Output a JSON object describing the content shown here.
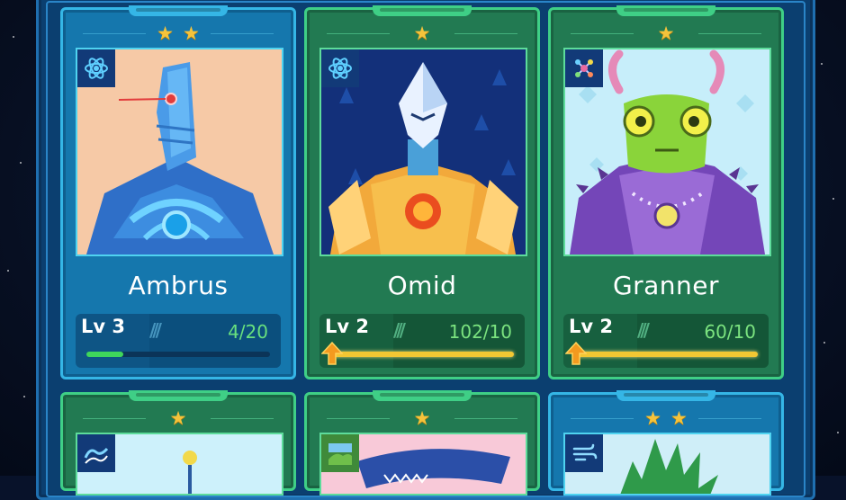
{
  "colors": {
    "star": "#f5c33b",
    "progress_text": "#68e07e",
    "card_blue": "#1577ad",
    "card_green": "#227a52"
  },
  "cards": [
    {
      "name": "Ambrus",
      "stars": 2,
      "element_icon": "atom-icon",
      "level": "Lv 3",
      "progress": "4/20",
      "progress_fraction": 0.2,
      "upgrade_ready": false
    },
    {
      "name": "Omid",
      "stars": 1,
      "element_icon": "atom-icon",
      "level": "Lv 2",
      "progress": "102/10",
      "progress_fraction": 1.0,
      "upgrade_ready": true
    },
    {
      "name": "Granner",
      "stars": 1,
      "element_icon": "molecule-icon",
      "level": "Lv 2",
      "progress": "60/10",
      "progress_fraction": 1.0,
      "upgrade_ready": true
    }
  ],
  "bottom_cards": [
    {
      "stars": 1,
      "element_icon": "wave-icon"
    },
    {
      "stars": 1,
      "element_icon": "landscape-icon"
    },
    {
      "stars": 2,
      "element_icon": "wind-icon"
    }
  ]
}
